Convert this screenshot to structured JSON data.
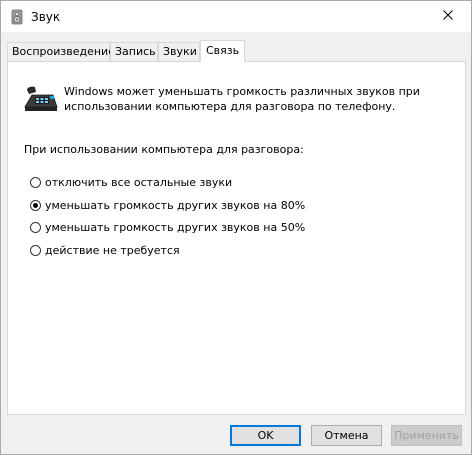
{
  "window": {
    "title": "Звук"
  },
  "tabs": [
    {
      "label": "Воспроизведение",
      "active": false
    },
    {
      "label": "Запись",
      "active": false
    },
    {
      "label": "Звуки",
      "active": false
    },
    {
      "label": "Связь",
      "active": true
    }
  ],
  "communications": {
    "description": "Windows может уменьшать громкость различных звуков при использовании компьютера для разговора по телефону.",
    "section_label": "При использовании компьютера для разговора:",
    "options": [
      {
        "label": "отключить все остальные звуки",
        "checked": false
      },
      {
        "label": "уменьшать громкость других звуков на 80%",
        "checked": true
      },
      {
        "label": "уменьшать громкость других звуков на 50%",
        "checked": false
      },
      {
        "label": "действие не требуется",
        "checked": false
      }
    ]
  },
  "buttons": {
    "ok": "OK",
    "cancel": "Отмена",
    "apply": "Применить"
  },
  "colors": {
    "accent": "#0078d7",
    "background": "#f0f0f0",
    "panel": "#ffffff"
  },
  "icons": {
    "title": "speaker-icon",
    "close": "close-icon",
    "phone": "telephone-icon"
  }
}
